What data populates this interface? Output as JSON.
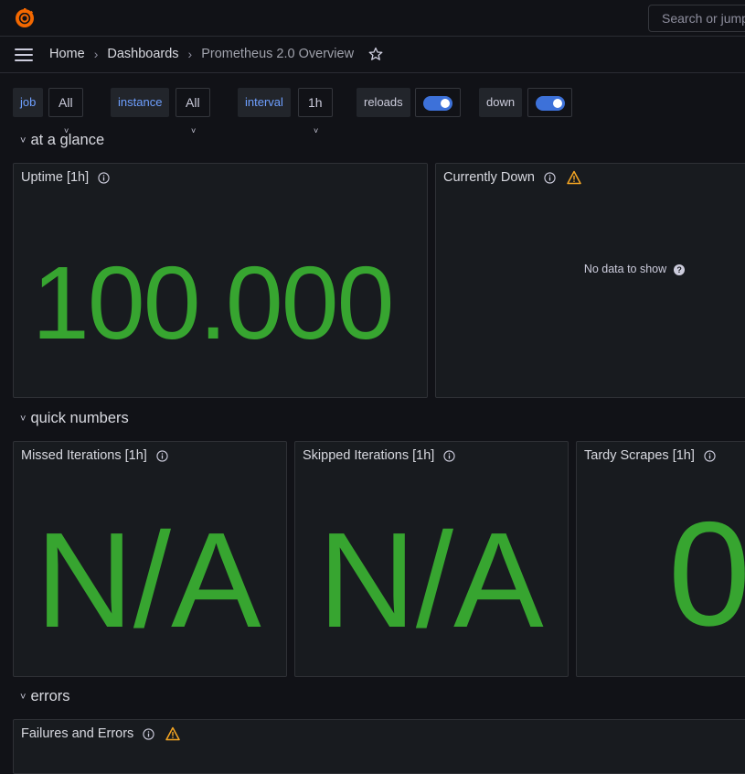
{
  "topbar": {
    "logo_icon": "grafana-logo-icon",
    "search": {
      "placeholder": "Search or jump to..."
    }
  },
  "breadcrumbs": [
    "Home",
    "Dashboards",
    "Prometheus 2.0 Overview"
  ],
  "variables": {
    "job": {
      "label": "job",
      "value": "All"
    },
    "instance": {
      "label": "instance",
      "value": "All"
    },
    "interval": {
      "label": "interval",
      "value": "1h"
    },
    "reloads": {
      "label": "reloads",
      "enabled": true
    },
    "down": {
      "label": "down",
      "enabled": true
    }
  },
  "rows": {
    "at_a_glance": "at a glance",
    "quick_numbers": "quick numbers",
    "errors": "errors"
  },
  "panels": {
    "uptime": {
      "title": "Uptime [1h]",
      "value": "100.000"
    },
    "currently_down": {
      "title": "Currently Down",
      "message": "No data to show"
    },
    "missed": {
      "title": "Missed Iterations [1h]",
      "value": "N/A"
    },
    "skipped": {
      "title": "Skipped Iterations [1h]",
      "value": "N/A"
    },
    "tardy": {
      "title": "Tardy Scrapes [1h]",
      "value": "0"
    },
    "failures": {
      "title": "Failures and Errors"
    }
  },
  "colors": {
    "stat_green": "#37a530",
    "accent_blue": "#6e9fff",
    "toggle_on": "#3d71d9",
    "warning": "#f5a623"
  }
}
